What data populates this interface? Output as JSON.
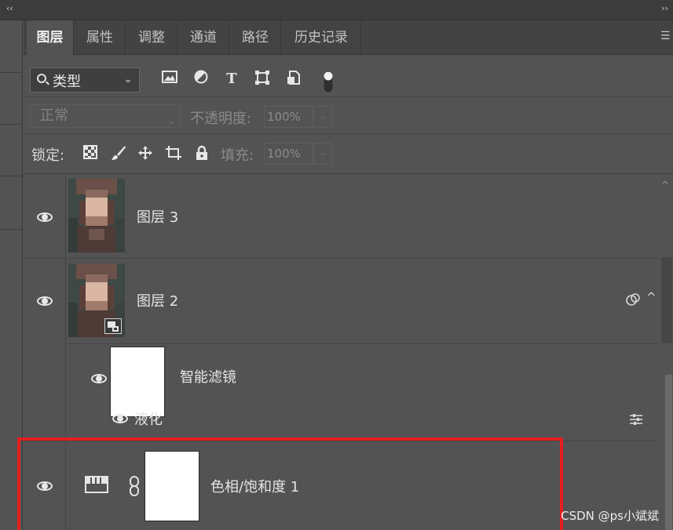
{
  "topbar": {
    "collapse_left": "‹‹",
    "collapse_right": "››"
  },
  "tabs": [
    {
      "label": "图层",
      "active": true
    },
    {
      "label": "属性"
    },
    {
      "label": "调整"
    },
    {
      "label": "通道"
    },
    {
      "label": "路径"
    },
    {
      "label": "历史记录"
    }
  ],
  "filter": {
    "kind_label": "类型",
    "icons": [
      "image-filter-icon",
      "adjustment-filter-icon",
      "type-filter-icon",
      "shape-filter-icon",
      "smart-object-filter-icon",
      "filter-toggle-icon"
    ]
  },
  "blend": {
    "mode": "正常",
    "opacity_label": "不透明度:",
    "opacity_value": "100%"
  },
  "lock": {
    "label": "锁定:",
    "fill_label": "填充:",
    "fill_value": "100%",
    "icons": [
      "lock-transparent-icon",
      "lock-image-icon",
      "lock-position-icon",
      "lock-artboard-icon",
      "lock-all-icon"
    ]
  },
  "layers": [
    {
      "name": "图层 3",
      "type": "pixel",
      "visible": true
    },
    {
      "name": "图层 2",
      "type": "smart-object",
      "visible": true
    },
    {
      "name": "智能滤镜",
      "type": "smart-filter-mask",
      "visible": true
    },
    {
      "name": "液化",
      "type": "filter",
      "visible": true
    },
    {
      "name": "色相/饱和度 1",
      "type": "adjustment",
      "visible": true,
      "highlighted": true
    }
  ],
  "watermark": "CSDN @ps小斌斌",
  "colors": {
    "panel_bg": "#535353",
    "tab_bg": "#434343",
    "highlight_border": "#e51f1f"
  }
}
